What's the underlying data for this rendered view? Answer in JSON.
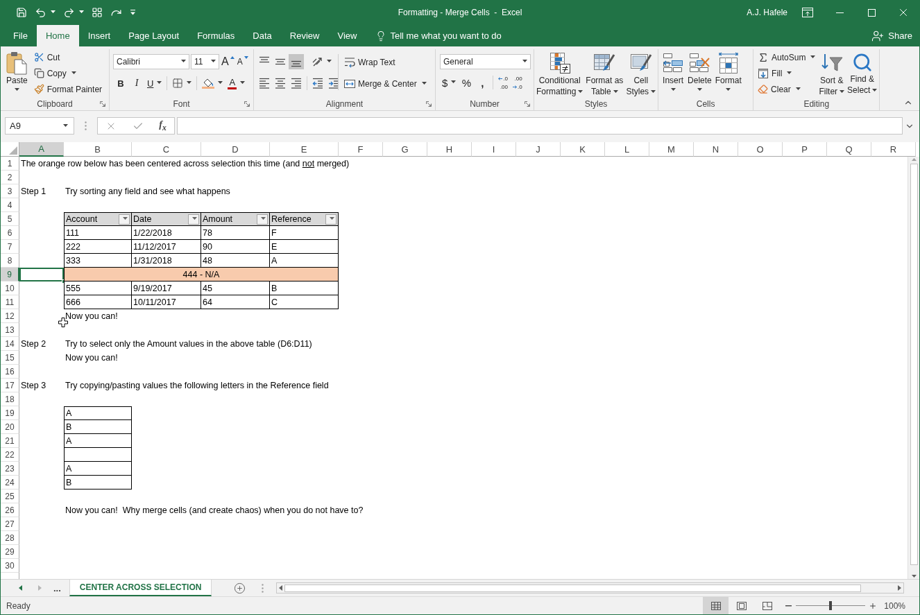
{
  "window": {
    "title": "Formatting - Merge Cells  -  Excel",
    "user": "A.J. Hafele"
  },
  "ribbon_tabs": [
    {
      "label": "File",
      "selected": false
    },
    {
      "label": "Home",
      "selected": true
    },
    {
      "label": "Insert",
      "selected": false
    },
    {
      "label": "Page Layout",
      "selected": false
    },
    {
      "label": "Formulas",
      "selected": false
    },
    {
      "label": "Data",
      "selected": false
    },
    {
      "label": "Review",
      "selected": false
    },
    {
      "label": "View",
      "selected": false
    }
  ],
  "tell_me": {
    "placeholder": "Tell me what you want to do"
  },
  "share": "Share",
  "ribbon": {
    "clipboard": {
      "paste": "Paste",
      "cut": "Cut",
      "copy": "Copy",
      "format_painter": "Format Painter",
      "label": "Clipboard"
    },
    "font": {
      "font_name": "Calibri",
      "font_size": "11",
      "grow": "A",
      "shrink": "A",
      "bold": "B",
      "italic": "I",
      "underline": "U",
      "font_color": "A",
      "label": "Font"
    },
    "alignment": {
      "vertical": [
        {
          "kind": "top",
          "selected": false
        },
        {
          "kind": "middle",
          "selected": false
        },
        {
          "kind": "bottom",
          "selected": true
        }
      ],
      "horizontal": [
        {
          "kind": "left",
          "selected": false
        },
        {
          "kind": "center",
          "selected": false
        },
        {
          "kind": "right",
          "selected": false
        }
      ],
      "wrap_text": "Wrap Text",
      "merge": "Merge & Center",
      "label": "Alignment"
    },
    "number": {
      "format": "General",
      "currency": "$",
      "percent": "%",
      "comma": ",",
      "increase_decimal": [
        ".0",
        ".00"
      ],
      "decrease_decimal": [
        ".00",
        ".0"
      ],
      "label": "Number"
    },
    "styles": {
      "buttons": [
        {
          "kind": "conditional_formatting",
          "label": "Conditional\nFormatting"
        },
        {
          "kind": "format_as_table",
          "label": "Format as\nTable"
        },
        {
          "kind": "cell_styles",
          "label": "Cell\nStyles"
        }
      ],
      "label": "Styles"
    },
    "cells": {
      "buttons": [
        {
          "kind": "insert",
          "label": "Insert"
        },
        {
          "kind": "delete",
          "label": "Delete"
        },
        {
          "kind": "format",
          "label": "Format"
        }
      ],
      "label": "Cells"
    },
    "editing": {
      "autosum": "AutoSum",
      "fill": "Fill",
      "clear": "Clear",
      "buttons": [
        {
          "kind": "sort_filter",
          "label": "Sort &\nFilter"
        },
        {
          "kind": "find_select",
          "label": "Find &\nSelect"
        }
      ],
      "label": "Editing"
    }
  },
  "formula_bar": {
    "name_box": "A9",
    "function_label": "f$_{x}$"
  },
  "sheet": {
    "columns": [
      {
        "label": "A",
        "selected": true
      },
      {
        "label": "B",
        "selected": false
      },
      {
        "label": "C",
        "selected": false
      },
      {
        "label": "D",
        "selected": false
      },
      {
        "label": "E",
        "selected": false
      },
      {
        "label": "F",
        "selected": false
      },
      {
        "label": "G",
        "selected": false
      },
      {
        "label": "H",
        "selected": false
      },
      {
        "label": "I",
        "selected": false
      },
      {
        "label": "J",
        "selected": false
      },
      {
        "label": "K",
        "selected": false
      },
      {
        "label": "L",
        "selected": false
      },
      {
        "label": "M",
        "selected": false
      },
      {
        "label": "N",
        "selected": false
      },
      {
        "label": "O",
        "selected": false
      },
      {
        "label": "P",
        "selected": false
      },
      {
        "label": "Q",
        "selected": false
      },
      {
        "label": "R",
        "selected": false
      }
    ],
    "rows": [
      {
        "label": "1",
        "selected": false,
        "cells": {
          "A": {
            "kind": "plain",
            "selected": false,
            "runs": [
              {
                "text": "The orange row below has been centered across selection this time (and ",
                "underline": false
              },
              {
                "text": "not",
                "underline": true
              },
              {
                "text": " merged)",
                "underline": false
              }
            ]
          }
        }
      },
      {
        "label": "2",
        "selected": false
      },
      {
        "label": "3",
        "selected": false,
        "cells": {
          "A": {
            "kind": "plain",
            "selected": false,
            "text": "Step 1"
          },
          "B": {
            "kind": "plain",
            "selected": false,
            "text": "Try sorting any field and see what happens"
          }
        }
      },
      {
        "label": "4",
        "selected": false
      },
      {
        "label": "5",
        "selected": false,
        "cells": {
          "B": {
            "kind": "header",
            "selected": false,
            "text": "Account"
          },
          "C": {
            "kind": "header",
            "selected": false,
            "text": "Date"
          },
          "D": {
            "kind": "header",
            "selected": false,
            "text": "Amount"
          },
          "E": {
            "kind": "header",
            "selected": false,
            "text": "Reference"
          }
        }
      },
      {
        "label": "6",
        "selected": false,
        "cells": {
          "B": {
            "kind": "table",
            "selected": false,
            "text": "111"
          },
          "C": {
            "kind": "table",
            "selected": false,
            "text": "1/22/2018"
          },
          "D": {
            "kind": "table",
            "selected": false,
            "text": "78"
          },
          "E": {
            "kind": "table",
            "selected": false,
            "text": "F"
          }
        }
      },
      {
        "label": "7",
        "selected": false,
        "cells": {
          "B": {
            "kind": "table",
            "selected": false,
            "text": "222"
          },
          "C": {
            "kind": "table",
            "selected": false,
            "text": "11/12/2017"
          },
          "D": {
            "kind": "table",
            "selected": false,
            "text": "90"
          },
          "E": {
            "kind": "table",
            "selected": false,
            "text": "E"
          }
        }
      },
      {
        "label": "8",
        "selected": false,
        "cells": {
          "B": {
            "kind": "table",
            "selected": false,
            "text": "333"
          },
          "C": {
            "kind": "table",
            "selected": false,
            "text": "1/31/2018"
          },
          "D": {
            "kind": "table",
            "selected": false,
            "text": "48"
          },
          "E": {
            "kind": "table",
            "selected": false,
            "text": "A"
          }
        }
      },
      {
        "label": "9",
        "selected": true,
        "cells": {
          "A": {
            "kind": "plain",
            "selected": true
          },
          "B": {
            "kind": "banner",
            "selected": false,
            "text": "444 - N/A"
          }
        }
      },
      {
        "label": "10",
        "selected": false,
        "cells": {
          "B": {
            "kind": "table",
            "selected": false,
            "text": "555"
          },
          "C": {
            "kind": "table",
            "selected": false,
            "text": "9/19/2017"
          },
          "D": {
            "kind": "table",
            "selected": false,
            "text": "45"
          },
          "E": {
            "kind": "table",
            "selected": false,
            "text": "B"
          }
        }
      },
      {
        "label": "11",
        "selected": false,
        "cells": {
          "B": {
            "kind": "table",
            "selected": false,
            "text": "666"
          },
          "C": {
            "kind": "table",
            "selected": false,
            "text": "10/11/2017"
          },
          "D": {
            "kind": "table",
            "selected": false,
            "text": "64"
          },
          "E": {
            "kind": "table",
            "selected": false,
            "text": "C"
          }
        }
      },
      {
        "label": "12",
        "selected": false,
        "cells": {
          "B": {
            "kind": "plain",
            "selected": false,
            "text": "Now you can!"
          }
        }
      },
      {
        "label": "13",
        "selected": false
      },
      {
        "label": "14",
        "selected": false,
        "cells": {
          "A": {
            "kind": "plain",
            "selected": false,
            "text": "Step 2"
          },
          "B": {
            "kind": "plain",
            "selected": false,
            "text": "Try to select only the Amount values in the above table (D6:D11)"
          }
        }
      },
      {
        "label": "15",
        "selected": false,
        "cells": {
          "B": {
            "kind": "plain",
            "selected": false,
            "text": "Now you can!"
          }
        }
      },
      {
        "label": "16",
        "selected": false
      },
      {
        "label": "17",
        "selected": false,
        "cells": {
          "A": {
            "kind": "plain",
            "selected": false,
            "text": "Step 3"
          },
          "B": {
            "kind": "plain",
            "selected": false,
            "text": "Try copying/pasting values the following letters in the Reference field"
          }
        }
      },
      {
        "label": "18",
        "selected": false
      },
      {
        "label": "19",
        "selected": false,
        "cells": {
          "B": {
            "kind": "table",
            "selected": false,
            "text": "A"
          }
        }
      },
      {
        "label": "20",
        "selected": false,
        "cells": {
          "B": {
            "kind": "table",
            "selected": false,
            "text": "B"
          }
        }
      },
      {
        "label": "21",
        "selected": false,
        "cells": {
          "B": {
            "kind": "table",
            "selected": false,
            "text": "A"
          }
        }
      },
      {
        "label": "22",
        "selected": false,
        "cells": {
          "B": {
            "kind": "table",
            "selected": false
          }
        }
      },
      {
        "label": "23",
        "selected": false,
        "cells": {
          "B": {
            "kind": "table",
            "selected": false,
            "text": "A"
          }
        }
      },
      {
        "label": "24",
        "selected": false,
        "cells": {
          "B": {
            "kind": "table",
            "selected": false,
            "text": "B"
          }
        }
      },
      {
        "label": "25",
        "selected": false
      },
      {
        "label": "26",
        "selected": false,
        "cells": {
          "B": {
            "kind": "plain",
            "selected": false,
            "text": "Now you can!  Why merge cells (and create chaos) when you do not have to?"
          }
        }
      },
      {
        "label": "27",
        "selected": false
      },
      {
        "label": "28",
        "selected": false
      },
      {
        "label": "29",
        "selected": false
      },
      {
        "label": "30",
        "selected": false
      }
    ]
  },
  "sheet_tabs": {
    "overflow": "...",
    "tabs": [
      {
        "label": "CENTER ACROSS SELECTION",
        "selected": true
      }
    ]
  },
  "status_bar": {
    "status": "Ready",
    "views": [
      {
        "kind": "normal",
        "selected": true
      },
      {
        "kind": "page_layout",
        "selected": false
      },
      {
        "kind": "page_break",
        "selected": false
      }
    ],
    "zoom": {
      "level": 0.5,
      "reading": "100%"
    }
  }
}
